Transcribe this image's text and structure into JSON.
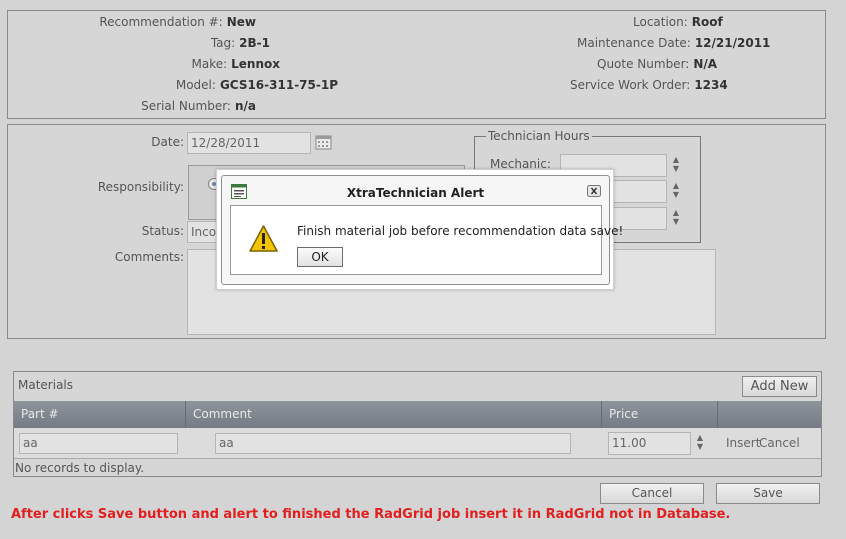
{
  "info": {
    "left": [
      {
        "label": "Recommendation #:",
        "value": "New"
      },
      {
        "label": "Tag:",
        "value": "2B-1"
      },
      {
        "label": "Make:",
        "value": "Lennox"
      },
      {
        "label": "Model:",
        "value": "GCS16-311-75-1P"
      },
      {
        "label": "Serial Number:",
        "value": "n/a"
      }
    ],
    "right": [
      {
        "label": "Location:",
        "value": "Roof"
      },
      {
        "label": "Maintenance Date:",
        "value": "12/21/2011"
      },
      {
        "label": "Quote Number:",
        "value": "N/A"
      },
      {
        "label": "Service Work Order:",
        "value": "1234"
      }
    ]
  },
  "form": {
    "date_label": "Date:",
    "date_value": "12/28/2011",
    "responsibility_label": "Responsibility:",
    "status_label": "Status:",
    "status_value": "Inco",
    "comments_label": "Comments:",
    "tech_hours_legend": "Technician Hours",
    "mechanic_label": "Mechanic:"
  },
  "materials": {
    "title": "Materials",
    "add_new_label": "Add New",
    "columns": [
      "Part #",
      "Comment",
      "Price"
    ],
    "edit_row": {
      "part": "aa",
      "comment": "aa",
      "price": "11.00",
      "insert_label": "Insert",
      "cancel_label": "Cancel"
    },
    "no_records": "No records to display."
  },
  "footer": {
    "cancel_label": "Cancel",
    "save_label": "Save",
    "note": "After clicks Save button and alert to finished the RadGrid job insert it in RadGrid not in Database."
  },
  "alert": {
    "title": "XtraTechnician Alert",
    "message": "Finish material job before recommendation data save!",
    "ok_label": "OK"
  },
  "colors": {
    "background": "#d4d4d4",
    "grid_header": "#7f868e",
    "note_text": "#e02020"
  }
}
